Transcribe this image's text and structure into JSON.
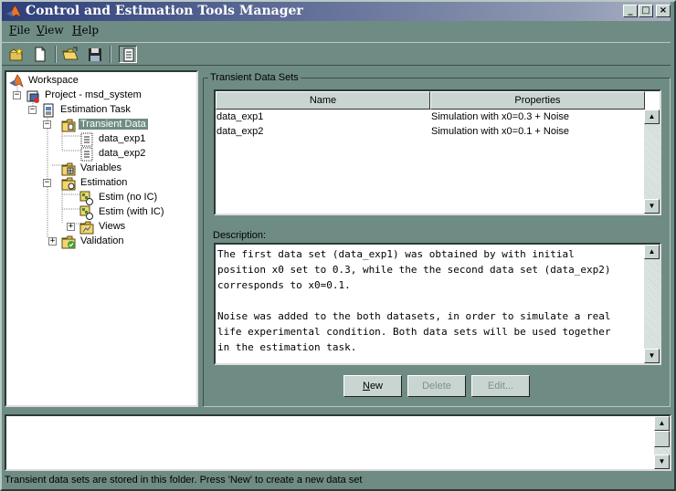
{
  "window": {
    "title": "Control and Estimation Tools Manager"
  },
  "menu": [
    {
      "label": "File",
      "u": "F",
      "rest": "ile"
    },
    {
      "label": "View",
      "u": "V",
      "rest": "iew"
    },
    {
      "label": "Help",
      "u": "H",
      "rest": "elp"
    }
  ],
  "toolbar": [
    "new-project-icon",
    "new-file-icon",
    "open-folder-icon",
    "save-icon",
    "toggle-view-icon"
  ],
  "tree": {
    "workspace": "Workspace",
    "project": "Project - msd_system",
    "estimation_task": "Estimation Task",
    "transient_data": "Transient Data",
    "data_exp1": "data_exp1",
    "data_exp2": "data_exp2",
    "variables": "Variables",
    "estimation": "Estimation",
    "estim_no_ic": "Estim (no IC)",
    "estim_with_ic": "Estim (with IC)",
    "views": "Views",
    "validation": "Validation"
  },
  "panel": {
    "group_title": "Transient Data Sets",
    "columns": [
      "Name",
      "Properties"
    ],
    "rows": [
      {
        "name": "data_exp1",
        "properties": "Simulation with x0=0.3 + Noise"
      },
      {
        "name": "data_exp2",
        "properties": "Simulation with x0=0.1 + Noise"
      }
    ],
    "description_label": "Description:",
    "description": [
      "The first data set (data_exp1) was obtained by with initial",
      "position x0 set to 0.3, while the the second data set (data_exp2)",
      "corresponds to x0=0.1.",
      "",
      "Noise was added to the both datasets, in order to simulate a real",
      "life experimental condition. Both data sets will be used together",
      "in the estimation task."
    ],
    "buttons": {
      "new": "New",
      "new_u": "N",
      "new_rest": "ew",
      "delete": "Delete",
      "edit": "Edit..."
    }
  },
  "status": "Transient data sets are stored in this folder. Press 'New' to create a new data set",
  "colors": {
    "background": "#6f8c84",
    "title_gradient_start": "#2e3f7a",
    "selected": "#6f8c84"
  }
}
